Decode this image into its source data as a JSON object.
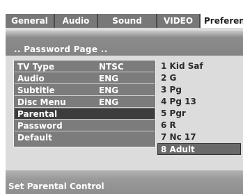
{
  "tabs": [
    {
      "label": "General"
    },
    {
      "label": "Audio"
    },
    {
      "label": "Sound"
    },
    {
      "label": "VIDEO"
    },
    {
      "label": "Preferen"
    }
  ],
  "active_tab": "Preferen",
  "page_title": ".. Password Page ..",
  "menu": [
    {
      "label": "TV Type",
      "value": "NTSC"
    },
    {
      "label": "Audio",
      "value": "ENG"
    },
    {
      "label": "Subtitle",
      "value": "ENG"
    },
    {
      "label": "Disc Menu",
      "value": "ENG"
    },
    {
      "label": "Parental",
      "value": ""
    },
    {
      "label": "Password",
      "value": ""
    },
    {
      "label": "Default",
      "value": ""
    }
  ],
  "selected_menu_item": "Parental",
  "parental_options": [
    {
      "label": "1 Kid Saf"
    },
    {
      "label": "2 G"
    },
    {
      "label": "3 Pg"
    },
    {
      "label": "4 Pg 13"
    },
    {
      "label": "5 Pgr"
    },
    {
      "label": "6 R"
    },
    {
      "label": "7 Nc 17"
    },
    {
      "label": "8 Adult"
    }
  ],
  "selected_option": "8 Adult",
  "status": "Set Parental Control",
  "colors": {
    "tab_bar": "#787878",
    "panel": "#dcdcdc",
    "menu_row": "#7c7c7c",
    "menu_selected": "#3c3c3c",
    "option_selected": "#6a6a6a"
  }
}
